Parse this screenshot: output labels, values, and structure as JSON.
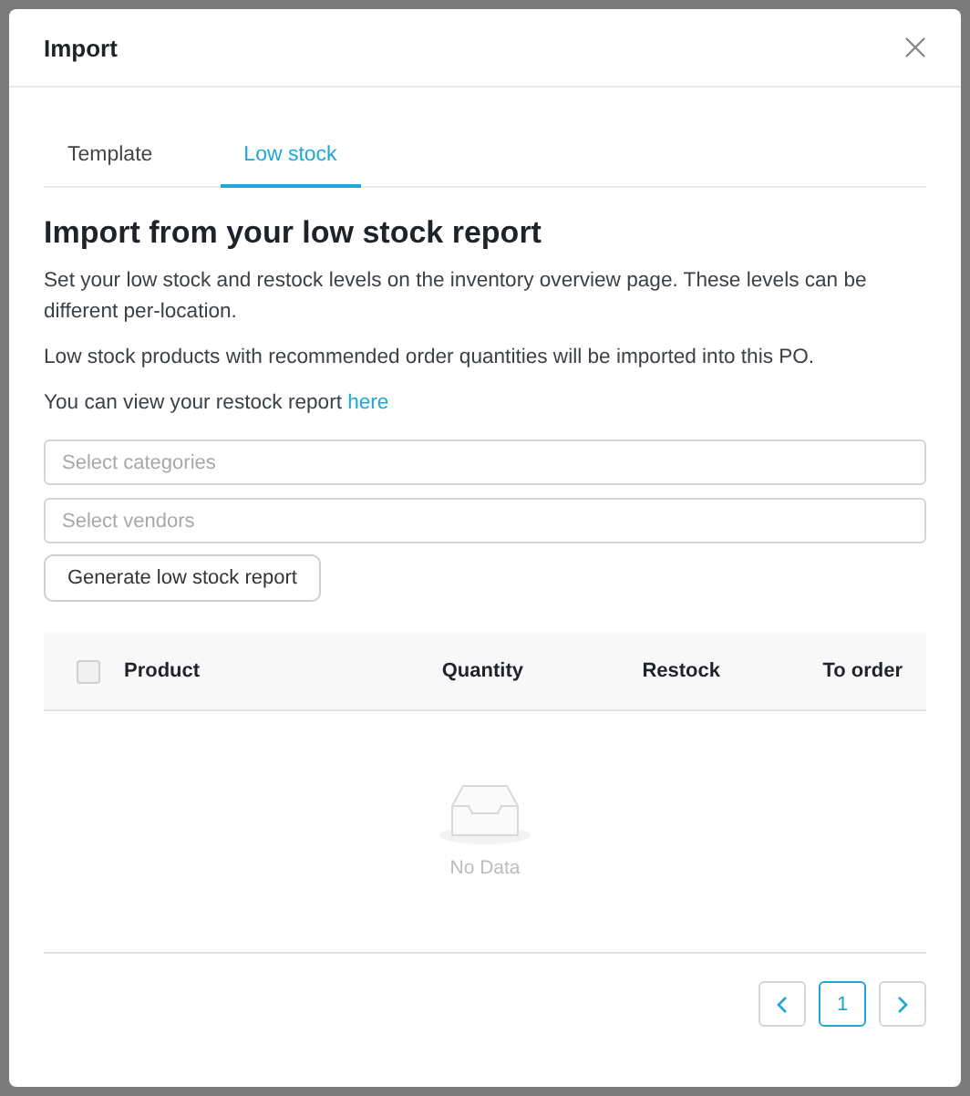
{
  "dialog": {
    "title": "Import"
  },
  "tabs": [
    {
      "label": "Template",
      "selected": false
    },
    {
      "label": "Low stock",
      "selected": true
    }
  ],
  "heading": "Import from your low stock report",
  "paragraphs": [
    "Set your low stock and restock levels on the inventory overview page. These levels can be different per-location.",
    "Low stock products with recommended order quantities will be imported into this PO."
  ],
  "report_line": {
    "text": "You can view your restock report",
    "link": "here"
  },
  "fields": [
    {
      "placeholder": "Select categories"
    },
    {
      "placeholder": "Select vendors"
    }
  ],
  "generate_button": "Generate low stock report",
  "table": {
    "select_all_checked": false,
    "columns": [
      {
        "label": "Product"
      },
      {
        "label": "Quantity"
      },
      {
        "label": "Restock"
      },
      {
        "label": "To order"
      }
    ],
    "empty_text": "No Data"
  },
  "pagination": {
    "pages": [
      {
        "label": "1",
        "selected": true
      }
    ]
  }
}
